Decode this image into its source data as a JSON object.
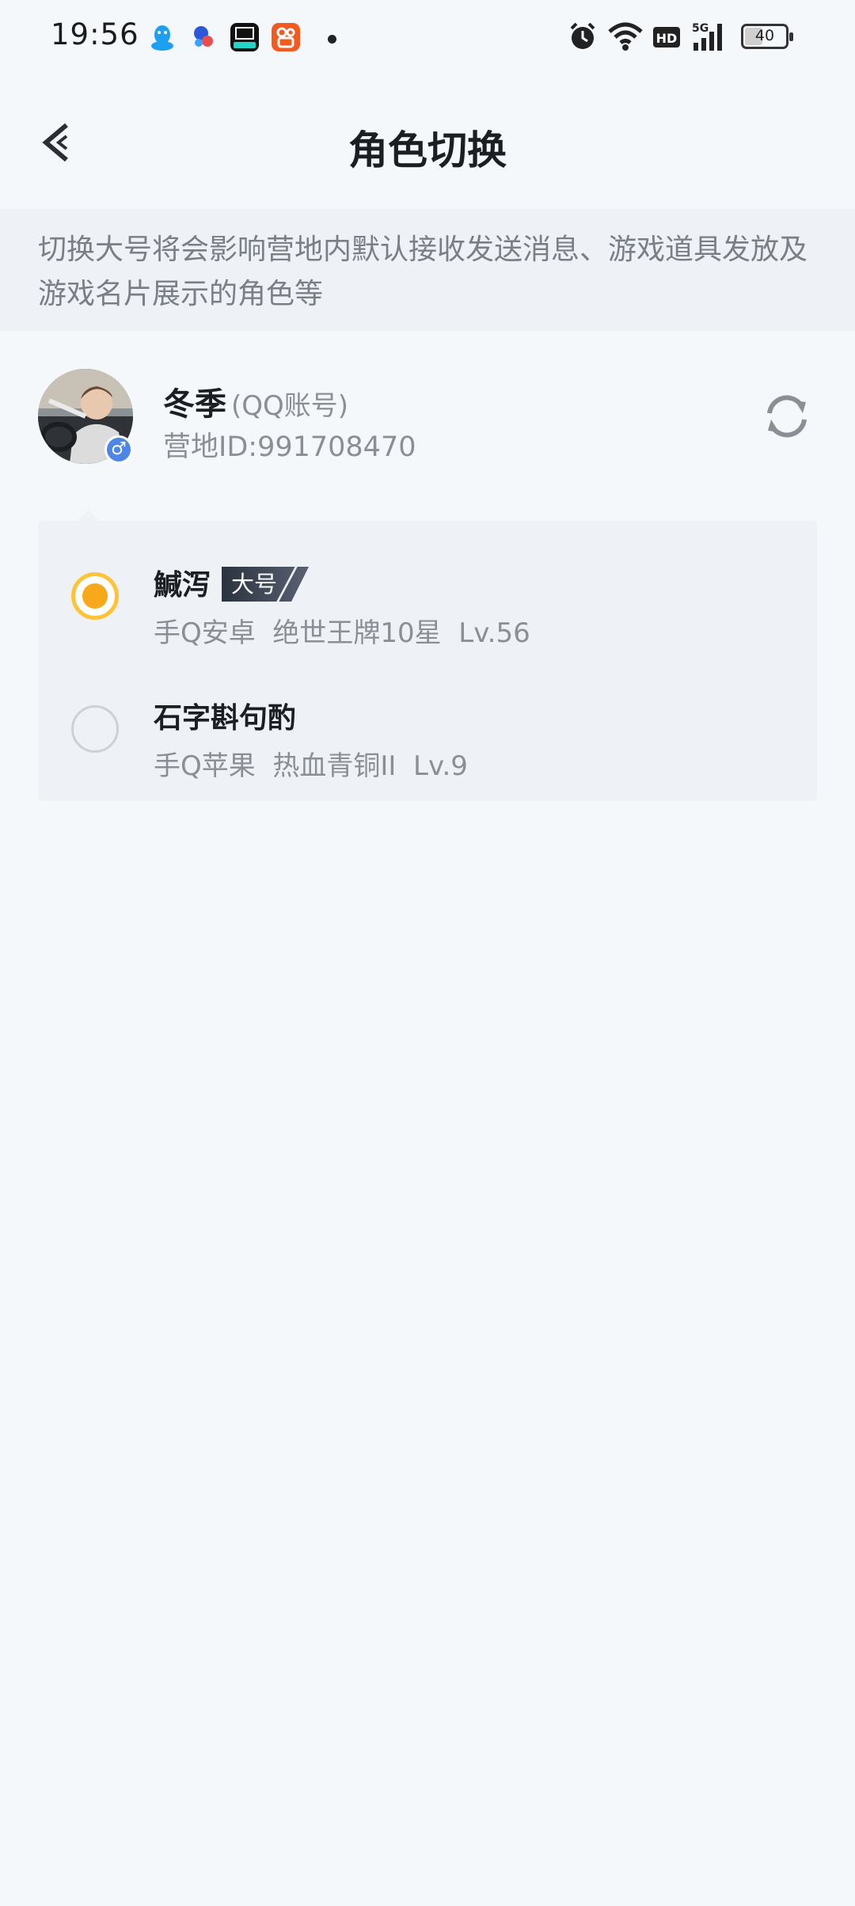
{
  "status_bar": {
    "time": "19:56",
    "notification_icons": [
      "qq-icon",
      "app-icon",
      "video-app-icon",
      "kuaishou-icon"
    ],
    "right_icons": [
      "alarm-icon",
      "wifi-icon",
      "hd-icon",
      "5g-signal-icon"
    ],
    "battery": "40",
    "battery_level": 0.4
  },
  "header": {
    "title": "角色切换",
    "back_icon": "back-arrow-icon"
  },
  "notice": {
    "text": "切换大号将会影响营地内默认接收发送消息、游戏道具发放及游戏名片展示的角色等"
  },
  "account": {
    "name": "冬季",
    "type": "(QQ账号)",
    "id_text": "营地ID:991708470",
    "gender_symbol": "♂",
    "refresh_icon": "refresh-icon"
  },
  "roles": [
    {
      "name": "鰔泻",
      "tag": "大号",
      "info": "手Q安卓  绝世王牌10星  Lv.56",
      "selected": true
    },
    {
      "name": "石字斟句酌",
      "tag": "",
      "info": "手Q苹果  热血青铜II  Lv.9",
      "selected": false
    }
  ],
  "colors": {
    "accent": "#f7a81b",
    "background": "#f5f8fb",
    "card": "#eef1f5"
  }
}
